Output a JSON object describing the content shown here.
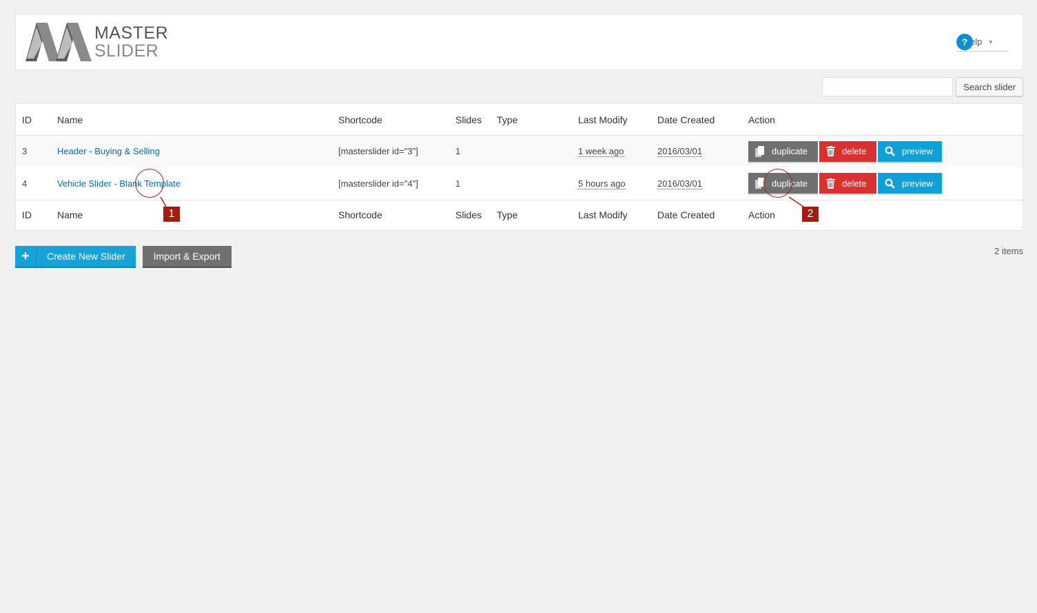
{
  "logo": {
    "line1": "MASTER",
    "line2": "SLIDER"
  },
  "help": {
    "icon": "question-icon",
    "label": "elp",
    "caret": "▼"
  },
  "search": {
    "placeholder": "",
    "value": "",
    "button_label": "Search slider"
  },
  "table": {
    "columns": [
      "ID",
      "Name",
      "Shortcode",
      "Slides",
      "Type",
      "Last Modify",
      "Date Created",
      "Action"
    ],
    "rows": [
      {
        "id": "3",
        "name": "Header - Buying & Selling",
        "shortcode": "[masterslider id=\"3\"]",
        "slides": "1",
        "type": "",
        "last_modify": "1 week ago",
        "date_created": "2016/03/01"
      },
      {
        "id": "4",
        "name": "Vehicle Slider - Blank Template",
        "shortcode": "[masterslider id=\"4\"]",
        "slides": "1",
        "type": "",
        "last_modify": "5 hours ago",
        "date_created": "2016/03/01"
      }
    ],
    "actions": {
      "duplicate": "duplicate",
      "delete": "delete",
      "preview": "preview"
    }
  },
  "bottom": {
    "create_label": "Create New Slider",
    "create_icon": "+",
    "import_label": "Import & Export",
    "items_count": "2 items"
  },
  "annotations": [
    {
      "label": "1"
    },
    {
      "label": "2"
    }
  ],
  "colors": {
    "link": "#0073aa",
    "duplicate": "#707070",
    "delete": "#d93131",
    "preview": "#10a0d8",
    "create": "#18a3d8",
    "annotation": "#a31b12"
  }
}
